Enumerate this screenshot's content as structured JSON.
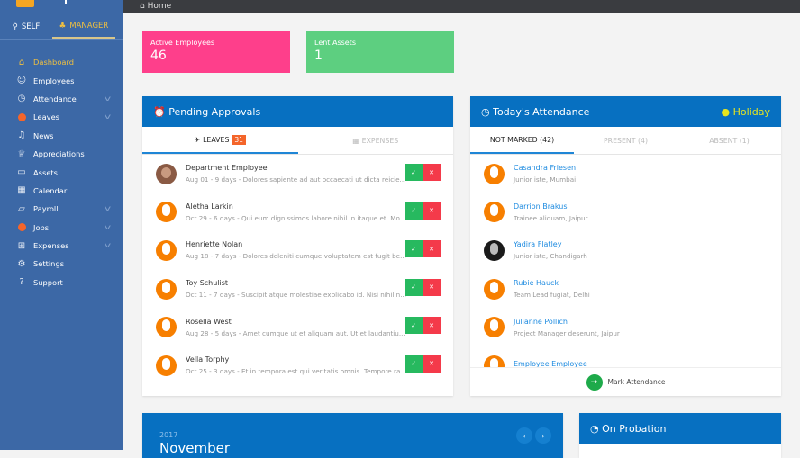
{
  "topbar": {
    "breadcrumb": "Home"
  },
  "sidebar": {
    "tabs": [
      {
        "label": "SELF"
      },
      {
        "label": "MANAGER"
      }
    ],
    "items": [
      {
        "label": "Dashboard",
        "icon": "home-icon"
      },
      {
        "label": "Employees",
        "icon": "users-icon"
      },
      {
        "label": "Attendance",
        "icon": "clock-icon"
      },
      {
        "label": "Leaves",
        "icon": "dot-icon"
      },
      {
        "label": "News",
        "icon": "bell-icon"
      },
      {
        "label": "Appreciations",
        "icon": "trophy-icon"
      },
      {
        "label": "Assets",
        "icon": "monitor-icon"
      },
      {
        "label": "Calendar",
        "icon": "calendar-icon"
      },
      {
        "label": "Payroll",
        "icon": "folder-icon"
      },
      {
        "label": "Jobs",
        "icon": "dot-icon"
      },
      {
        "label": "Expenses",
        "icon": "grid-icon"
      },
      {
        "label": "Settings",
        "icon": "gear-icon"
      },
      {
        "label": "Support",
        "icon": "help-icon"
      }
    ]
  },
  "stats": [
    {
      "label": "Active Employees",
      "value": "46",
      "color": "#fe3f8b"
    },
    {
      "label": "Lent Assets",
      "value": "1",
      "color": "#5dcf80"
    }
  ],
  "pending": {
    "title": "Pending Approvals",
    "tabs": {
      "leaves": "LEAVES",
      "leaves_count": "31",
      "expenses": "EXPENSES"
    },
    "rows": [
      {
        "name": "Department Employee",
        "detail": "Aug 01 - 9 days - Dolores sapiente ad aut occaecati ut dicta reicie..."
      },
      {
        "name": "Aletha Larkin",
        "detail": "Oct 29 - 6 days - Qui eum dignissimos labore nihil in itaque et. Mo..."
      },
      {
        "name": "Henriette Nolan",
        "detail": "Aug 18 - 7 days - Dolores deleniti cumque voluptatem est fugit be..."
      },
      {
        "name": "Toy Schulist",
        "detail": "Oct 11 - 7 days - Suscipit atque molestiae explicabo id. Nisi nihil n..."
      },
      {
        "name": "Rosella West",
        "detail": "Aug 28 - 5 days - Amet cumque ut et aliquam aut. Ut et laudantiu..."
      },
      {
        "name": "Vella Torphy",
        "detail": "Oct 25 - 3 days - Et in tempora est qui veritatis omnis. Tempore ra..."
      }
    ]
  },
  "attendance": {
    "title": "Today's Attendance",
    "holiday": "Holiday",
    "tabs": [
      "NOT MARKED (42)",
      "PRESENT (4)",
      "ABSENT (1)"
    ],
    "rows": [
      {
        "name": "Casandra Friesen",
        "detail": "Junior iste, Mumbai"
      },
      {
        "name": "Darrion Brakus",
        "detail": "Trainee aliquam, Jaipur"
      },
      {
        "name": "Yadira Flatley",
        "detail": "Junior iste, Chandigarh"
      },
      {
        "name": "Rubie Hauck",
        "detail": "Team Lead fugiat, Delhi"
      },
      {
        "name": "Julianne Pollich",
        "detail": "Project Manager deserunt, Jaipur"
      },
      {
        "name": "Employee Employee",
        "detail": ""
      }
    ],
    "mark_label": "Mark Attendance"
  },
  "calendar": {
    "year": "2017",
    "month": "November"
  },
  "probation": {
    "title": "On Probation"
  }
}
